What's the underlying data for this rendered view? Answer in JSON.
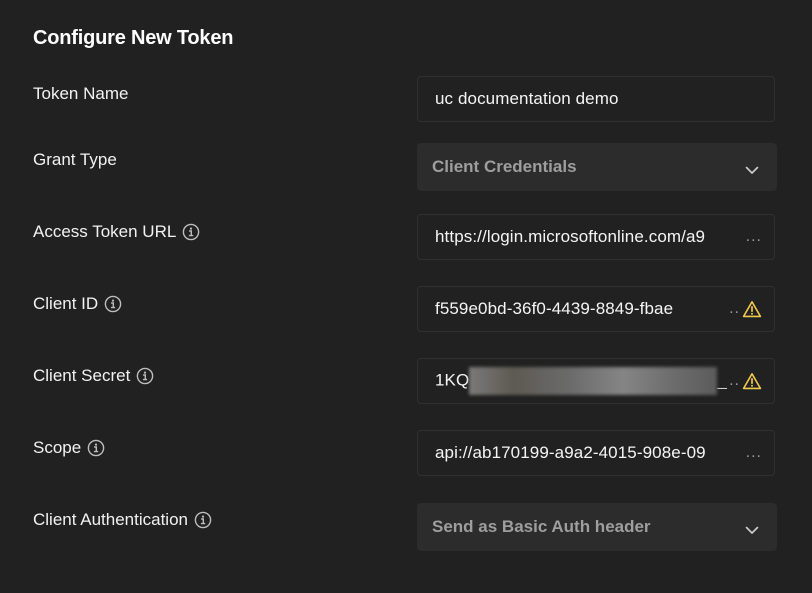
{
  "panel": {
    "title": "Configure New Token"
  },
  "fields": {
    "token_name": {
      "label": "Token Name",
      "value": "uc documentation demo"
    },
    "grant_type": {
      "label": "Grant Type",
      "selected": "Client Credentials"
    },
    "access_token_url": {
      "label": "Access Token URL",
      "value": "https://login.microsoftonline.com/a9",
      "truncation": "..."
    },
    "client_id": {
      "label": "Client ID",
      "value": "f559e0bd-36f0-4439-8849-fbae",
      "truncation": "..",
      "warning": true
    },
    "client_secret": {
      "label": "Client Secret",
      "value_prefix": "1KQ",
      "value_suffix": "_",
      "truncation": "..",
      "warning": true,
      "redacted": true
    },
    "scope": {
      "label": "Scope",
      "value": "api://ab170199-a9a2-4015-908e-09",
      "truncation": "..."
    },
    "client_authentication": {
      "label": "Client Authentication",
      "selected": "Send as Basic Auth header"
    }
  },
  "icons": {
    "info": "info-circle-icon",
    "warning": "warning-triangle-icon",
    "chevron": "chevron-down-icon"
  },
  "colors": {
    "background": "#212121",
    "field_border": "#303030",
    "select_background": "#2c2c2c",
    "warning": "#f2c94c",
    "muted_text": "#9e9e9e"
  }
}
